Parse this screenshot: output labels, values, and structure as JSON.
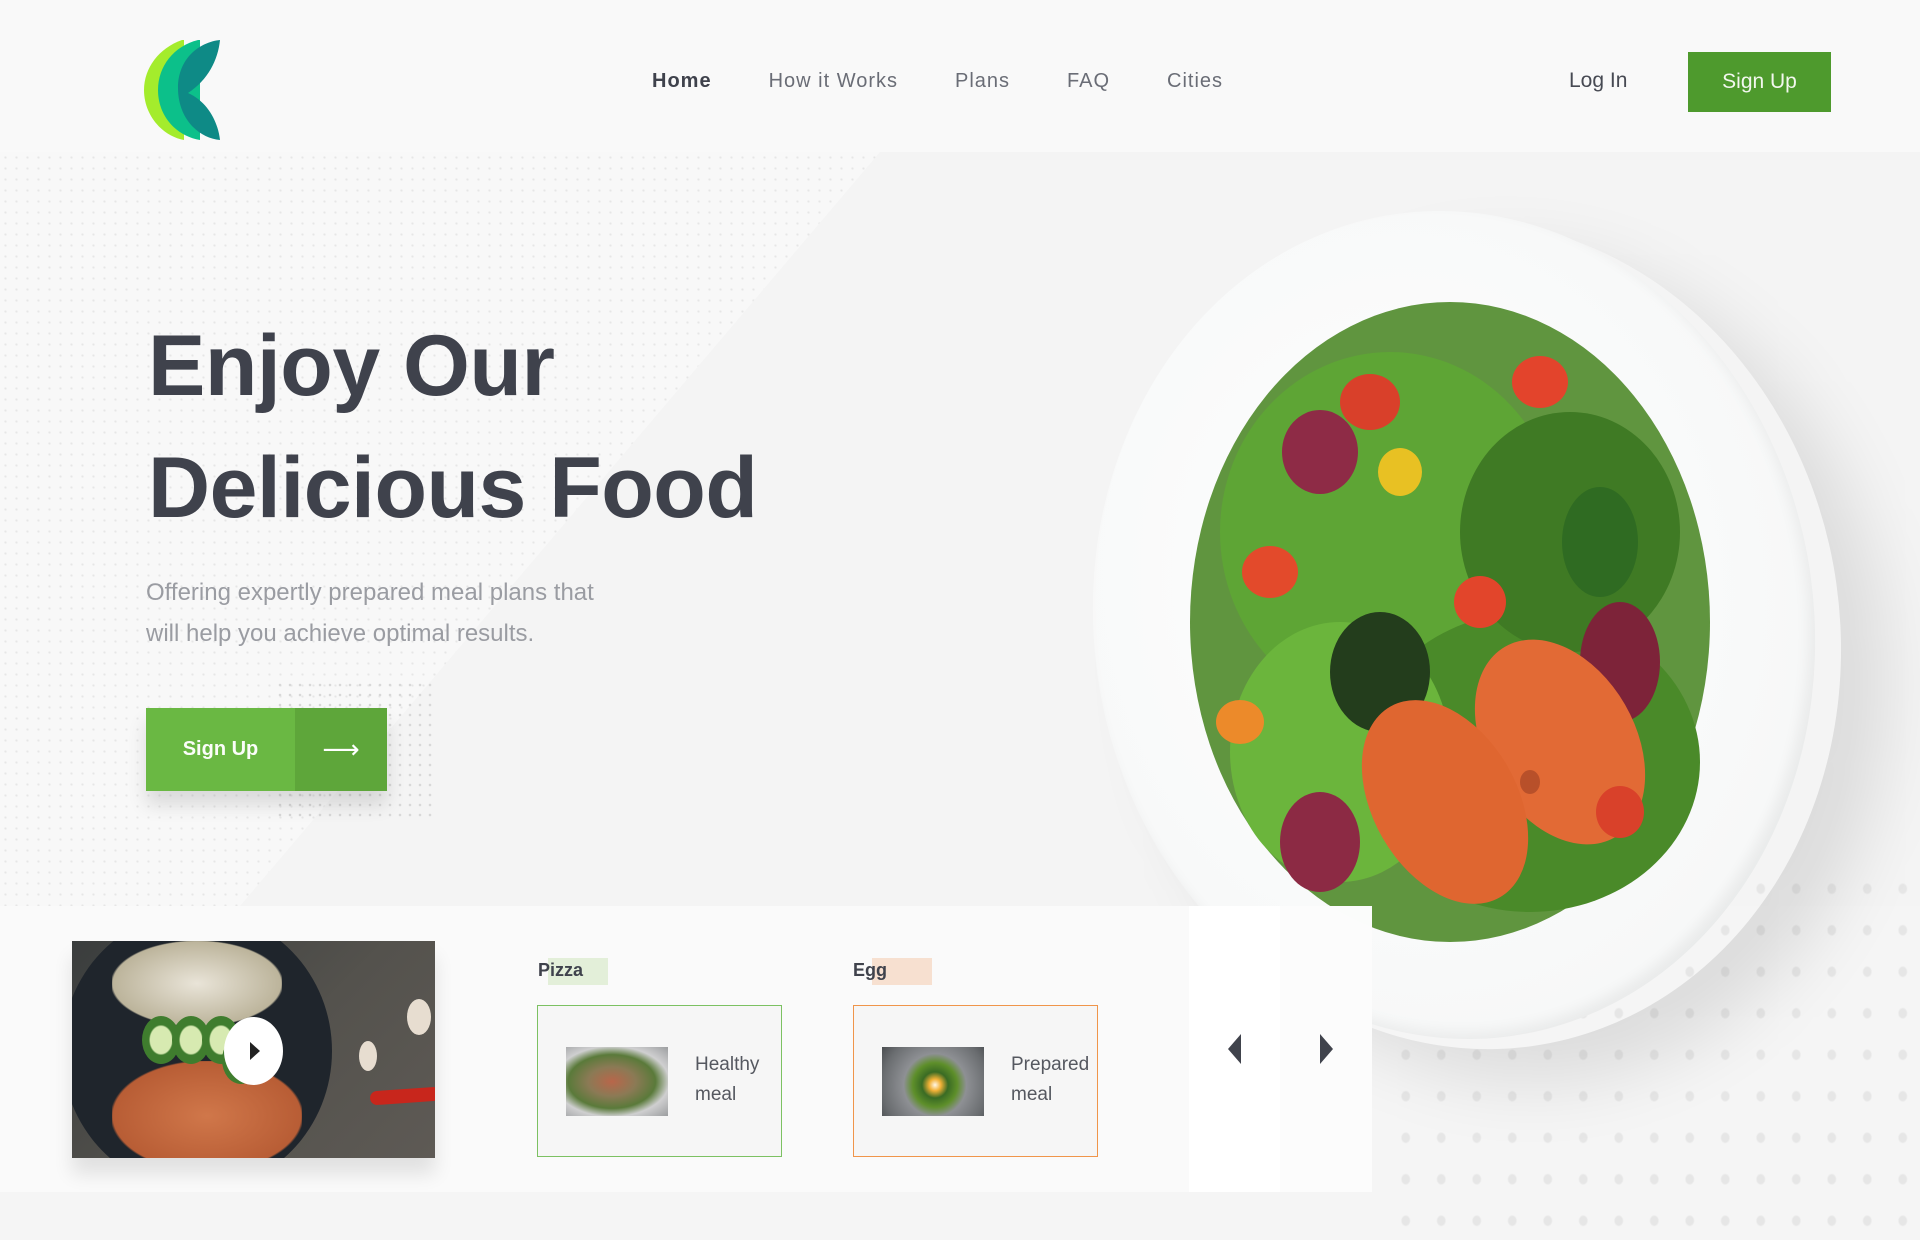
{
  "header": {
    "logo_name": "brand-logo",
    "nav": [
      {
        "label": "Home",
        "active": true
      },
      {
        "label": "How it Works",
        "active": false
      },
      {
        "label": "Plans",
        "active": false
      },
      {
        "label": "FAQ",
        "active": false
      },
      {
        "label": "Cities",
        "active": false
      }
    ],
    "login_label": "Log In",
    "signup_label": "Sign Up"
  },
  "hero": {
    "title_line1": "Enjoy Our",
    "title_line2": "Delicious Food",
    "subtitle_line1": "Offering expertly prepared meal plans that",
    "subtitle_line2": "will help you achieve optimal results.",
    "cta_label": "Sign Up",
    "cta_icon": "arrow-right-icon",
    "cta_arrow_glyph": "⟶"
  },
  "carousel": {
    "video_icon": "play-icon",
    "cards": [
      {
        "tag": "Pizza",
        "label_line1": "Healthy",
        "label_line2": "meal",
        "accent": "#7cc162",
        "tag_bg": "#e3efd9"
      },
      {
        "tag": "Egg",
        "label_line1": "Prepared",
        "label_line2": "meal",
        "accent": "#f0954a",
        "tag_bg": "#f7e0d0"
      }
    ],
    "prev_icon": "chevron-left-icon",
    "next_icon": "chevron-right-icon"
  },
  "colors": {
    "brand_green": "#4e9a2d",
    "cta_green": "#6ab843",
    "cta_green_dark": "#5ea63a",
    "text_dark": "#3f424c",
    "text_muted": "#9a9ca2"
  }
}
